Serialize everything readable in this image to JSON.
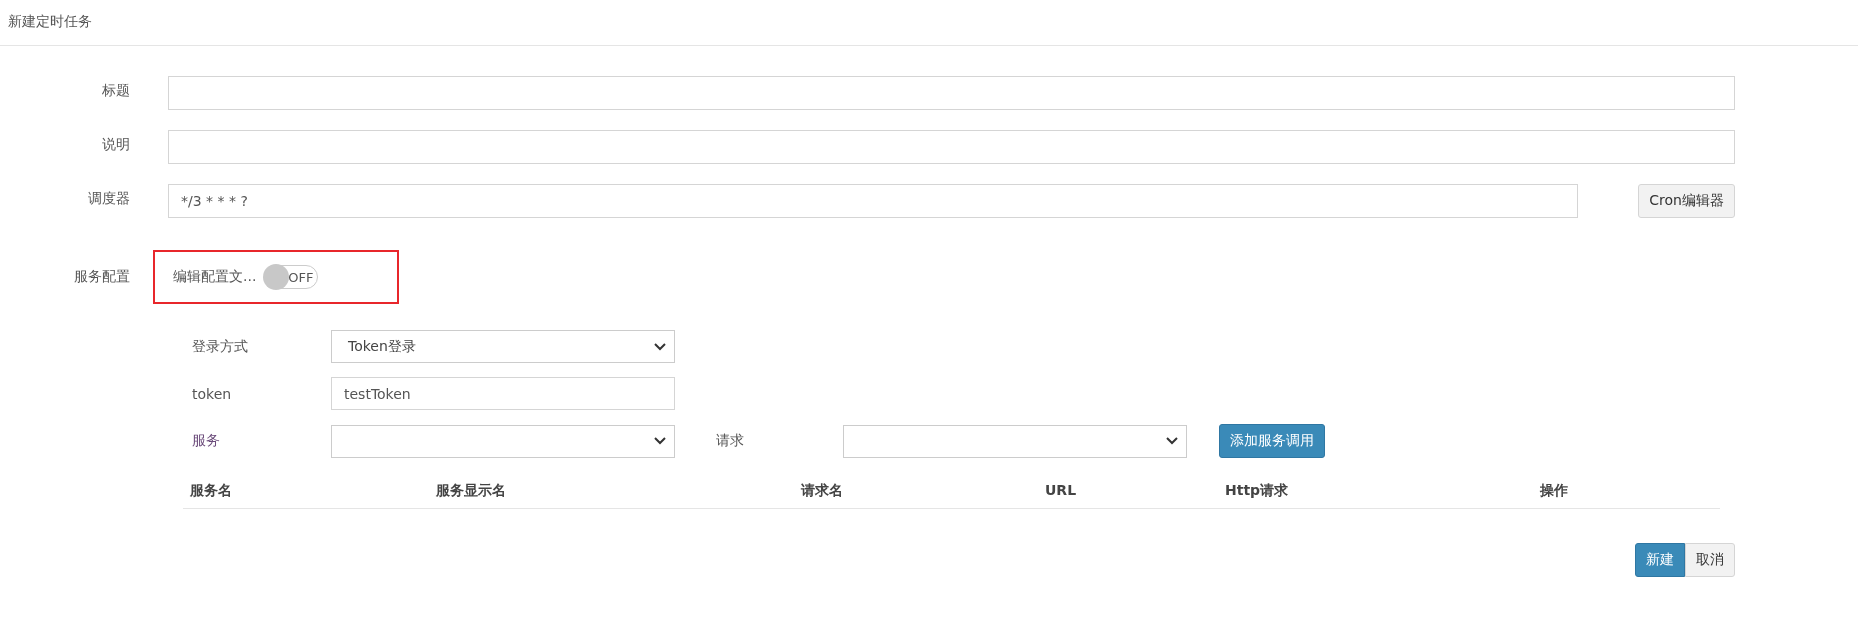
{
  "header": {
    "title": "新建定时任务"
  },
  "fields": [
    {
      "label": "标题"
    },
    {
      "label": "说明"
    },
    {
      "label": "调度器",
      "value": "*/3 * * * ?",
      "button": "Cron编辑器"
    }
  ],
  "service_config": {
    "label": "服务配置",
    "toggle": {
      "label": "编辑配置文...",
      "on": false,
      "state_text": "OFF"
    }
  },
  "login": {
    "label": "登录方式",
    "value": "Token登录"
  },
  "token": {
    "label": "token",
    "value": "testToken"
  },
  "service": {
    "label": "服务"
  },
  "request": {
    "label": "请求"
  },
  "add_button": "添加服务调用",
  "table": {
    "columns": [
      "服务名",
      "服务显示名",
      "请求名",
      "URL",
      "Http请求",
      "操作"
    ]
  },
  "buttons": [
    {
      "label": "新建",
      "kind": "primary"
    },
    {
      "label": "取消",
      "kind": "default"
    }
  ]
}
